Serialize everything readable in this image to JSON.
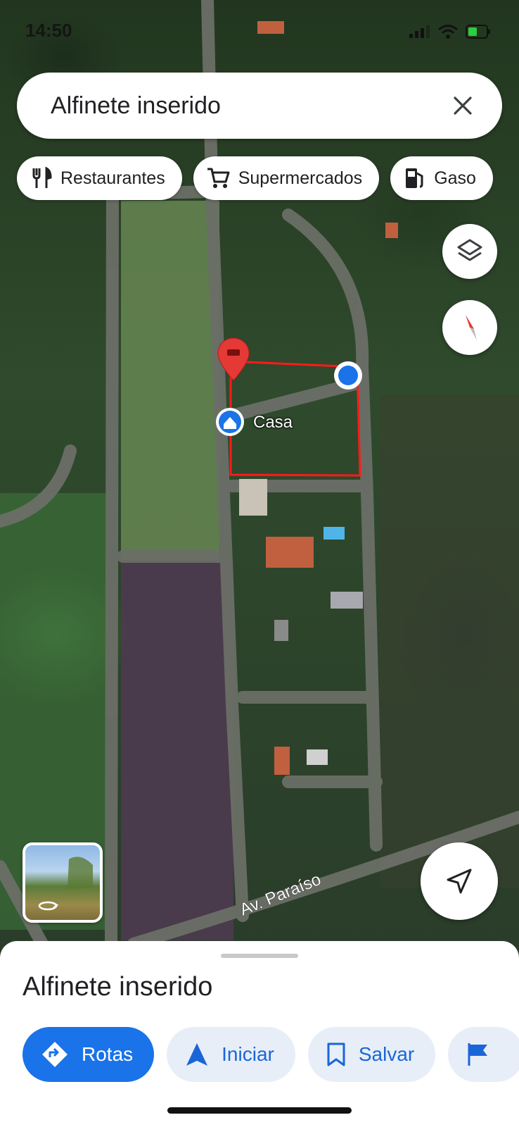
{
  "status_bar": {
    "time": "14:50"
  },
  "search": {
    "title": "Alfinete inserido"
  },
  "chips": [
    {
      "icon": "fork-knife-icon",
      "label": "Restaurantes"
    },
    {
      "icon": "cart-icon",
      "label": "Supermercados"
    },
    {
      "icon": "fuel-icon",
      "label": "Gaso"
    }
  ],
  "map": {
    "saved_place_label": "Casa",
    "road_label": "Av. Paraíso",
    "colors": {
      "pin": "#e53935",
      "outline": "#ff1a1a",
      "user_dot": "#1a73e8"
    }
  },
  "sheet": {
    "title": "Alfinete inserido",
    "actions": [
      {
        "icon": "directions-icon",
        "label": "Rotas"
      },
      {
        "icon": "navigation-arrow-icon",
        "label": "Iniciar"
      },
      {
        "icon": "bookmark-icon",
        "label": "Salvar"
      },
      {
        "icon": "flag-icon",
        "label": ""
      }
    ]
  },
  "accent": "#1a73e8"
}
